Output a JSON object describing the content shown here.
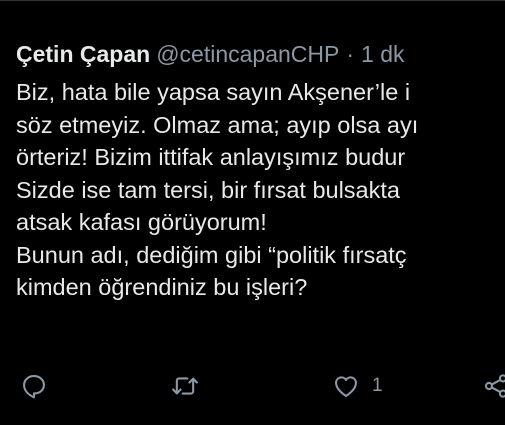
{
  "tweet": {
    "author": {
      "display_name": "Çetin Çapan",
      "handle": "@cetincapanCHP",
      "separator": "·",
      "timestamp": "1 dk"
    },
    "text_lines": [
      "Biz, hata bile yapsa sayın Akşener’le i",
      "söz etmeyiz. Olmaz ama; ayıp olsa ayı",
      "örteriz! Bizim ittifak anlayışımız budur",
      "Sizde ise tam tersi, bir fırsat bulsakta",
      "atsak kafası görüyorum!",
      "Bunun adı, dediğim gibi “politik fırsatç",
      "kimden öğrendiniz bu işleri?"
    ],
    "actions": {
      "reply": {
        "icon": "reply-icon",
        "count": ""
      },
      "retweet": {
        "icon": "retweet-icon",
        "count": ""
      },
      "like": {
        "icon": "heart-icon",
        "count": "1"
      },
      "share": {
        "icon": "share-icon",
        "count": ""
      }
    }
  },
  "colors": {
    "background": "#000000",
    "text_primary": "#e7e9ea",
    "text_secondary": "#8b98a5",
    "divider": "#2f3336"
  }
}
